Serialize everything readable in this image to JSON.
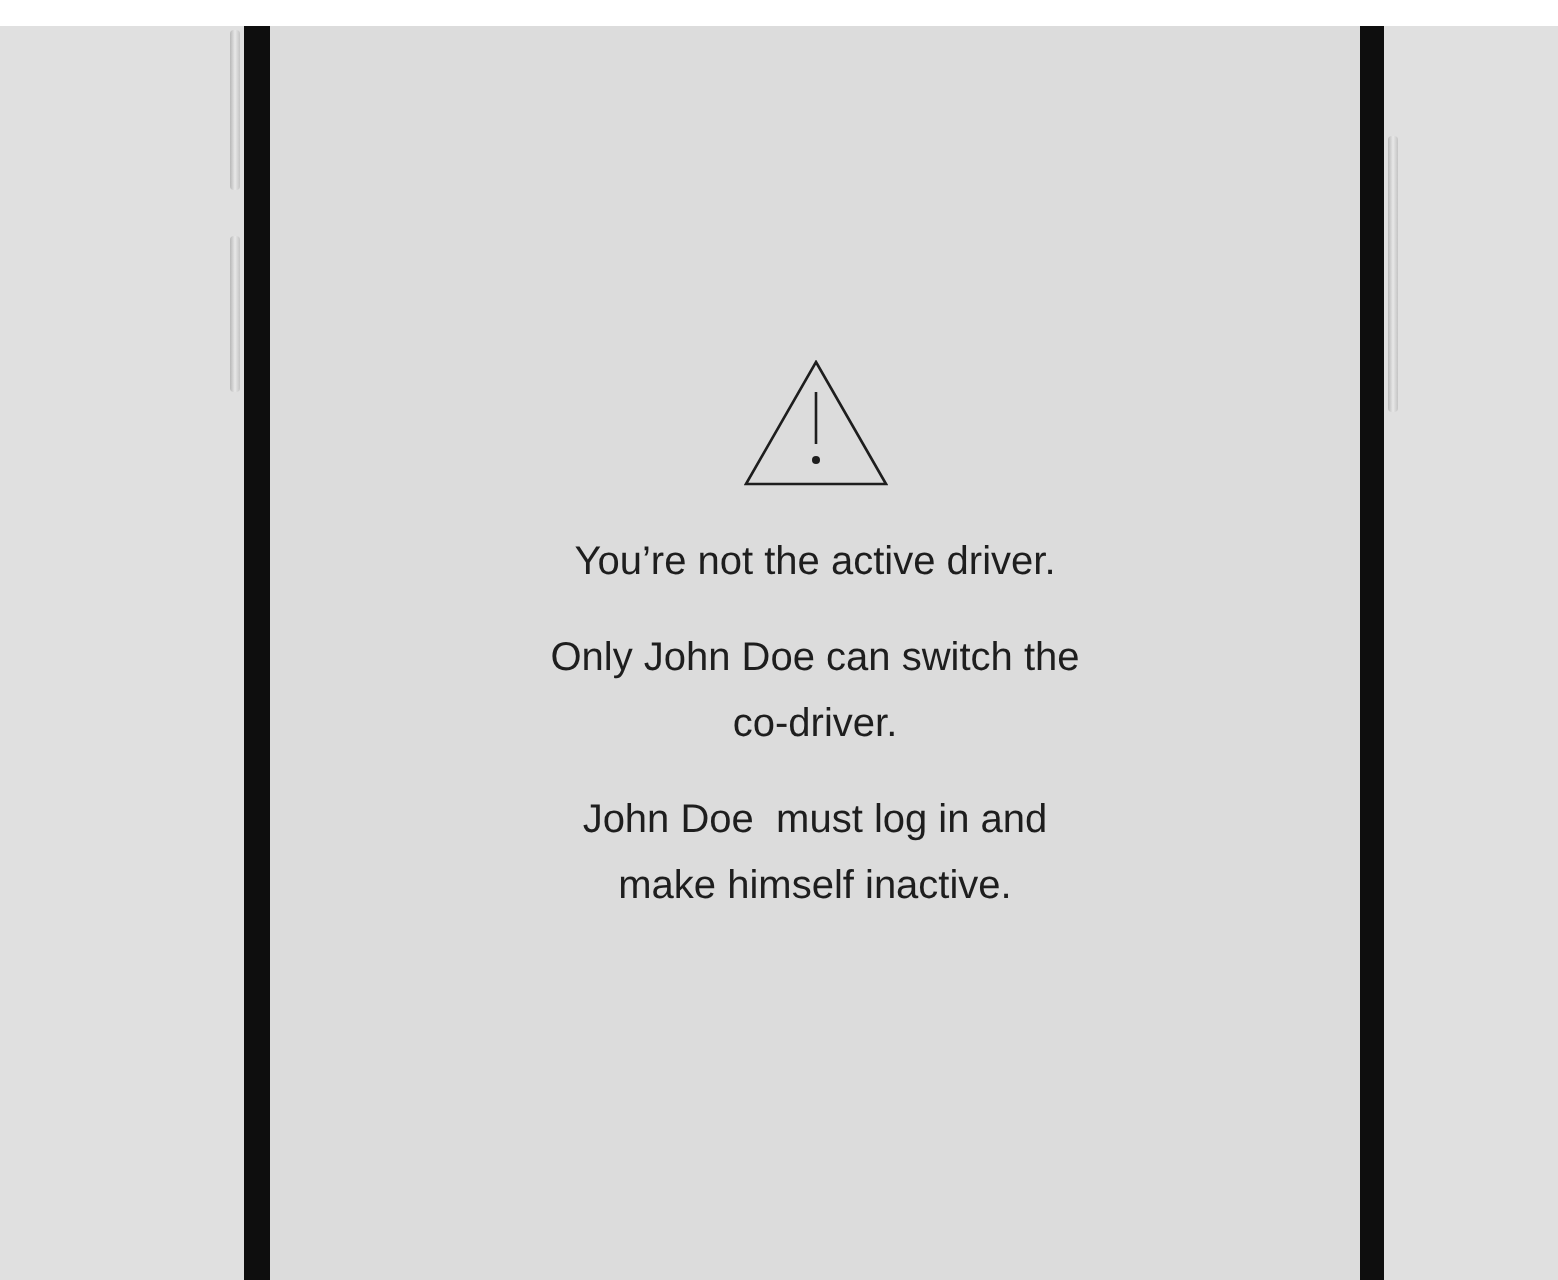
{
  "screen": {
    "alert": {
      "messages": [
        "You’re not the active driver.",
        "Only John Doe can switch the co-driver.",
        "John Doe  must log in and make himself inactive."
      ]
    }
  }
}
